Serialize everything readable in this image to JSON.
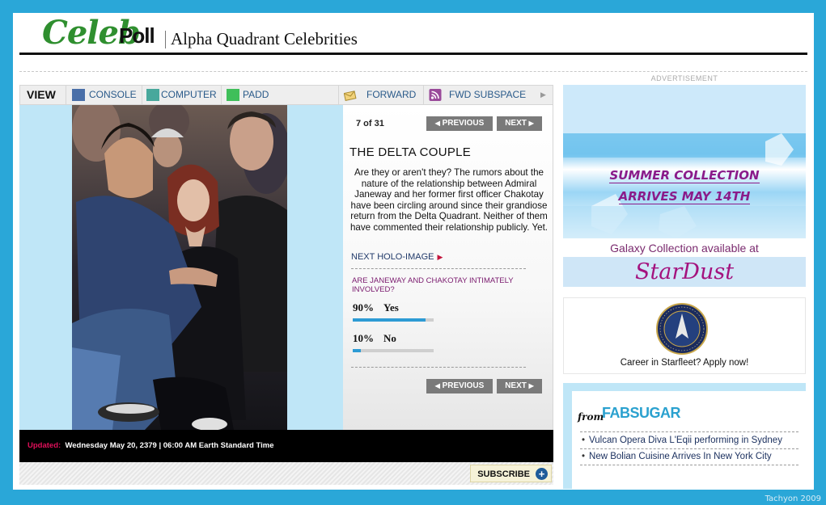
{
  "header": {
    "logo_script": "Celeb",
    "logo_bold": "Poll",
    "subtitle": "Alpha Quadrant Celebrities"
  },
  "toolbar": {
    "view": "VIEW",
    "items": [
      {
        "label": "CONSOLE",
        "color": "#4a6fa8"
      },
      {
        "label": "COMPUTER",
        "color": "#48a89c"
      },
      {
        "label": "PADD",
        "color": "#3fbf5a"
      }
    ],
    "forward": "FORWARD",
    "fwd_subspace": "FWD SUBSPACE"
  },
  "slideshow": {
    "count": "7 of 31",
    "previous": "PREVIOUS",
    "next": "NEXT",
    "title": "THE DELTA COUPLE",
    "body": "Are they or aren't they? The rumors about the nature of the relationship between Admiral Janeway and her former first officer Chakotay have been circling around since their grandiose return from the Delta Quadrant. Neither of them have commented their relationship publicly. Yet.",
    "next_link": "NEXT HOLO-IMAGE"
  },
  "poll": {
    "question": "ARE JANEWAY AND CHAKOTAY INTIMATELY INVOLVED?",
    "options": [
      {
        "percent_label": "90%",
        "label": "Yes",
        "value": 0.9
      },
      {
        "percent_label": "10%",
        "label": "No",
        "value": 0.1
      }
    ]
  },
  "status": {
    "updated_label": "Updated:",
    "updated_text": "Wednesday May 20, 2379 | 06:00 AM Earth Standard Time"
  },
  "subscribe": "SUBSCRIBE",
  "ads": {
    "advertisement": "ADVERTISEMENT",
    "summer_line1": "SUMMER COLLECTION",
    "summer_line2": "ARRIVES MAY 14TH",
    "galaxy": "Galaxy Collection available at",
    "brand": "StarDust",
    "starfleet": "Career in Starfleet? Apply now!"
  },
  "fab": {
    "from": "from",
    "brand": "FABSUGAR",
    "links": [
      "Vulcan Opera Diva L'Eqii performing in Sydney",
      "New Bolian Cuisine Arrives In New York City"
    ]
  },
  "watermark": "Tachyon 2009",
  "colors": {
    "frame": "#2aa7d8",
    "logo_green": "#2f8f2f",
    "accent_magenta": "#8a1b8a",
    "poll_bar": "#2d9bd4"
  }
}
